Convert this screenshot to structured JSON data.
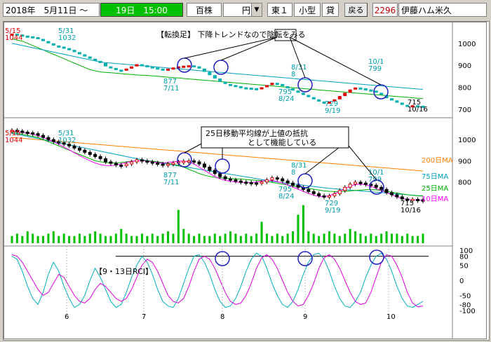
{
  "toolbar": {
    "date": "2018年　5月11日 ～",
    "time": "19日　15:00",
    "unit_label": "百株",
    "price_unit": "円",
    "dropdown_icon": "triangle-down",
    "market": "東１",
    "size": "小型",
    "lend": "貸",
    "back_label": "戻る",
    "code": "2296",
    "name": "伊藤ハム米久"
  },
  "annotations": {
    "top_note": "【転換足】 下降トレンドなので陰転をみる",
    "mid_note_line1": "25日移動平均線が上値の抵抗",
    "mid_note_line2": "として機能している",
    "rci_label": "【9・13日RCI】"
  },
  "colors": {
    "toolbar_time_bg": "#00c000",
    "ma200": "#ff8000",
    "ma75": "#00a0c0",
    "ma25": "#00b000",
    "ma10": "#ff00ff",
    "turn_up": "#e00000",
    "turn_down": "#00b0b0",
    "volume": "#00c000",
    "rci9": "#00b0c0",
    "rci13": "#e000e0",
    "circle": "#2020c0",
    "arrow": "#000000"
  },
  "chart_data": [
    {
      "type": "line",
      "panel": "turnover_bars",
      "title": "【転換足】 下降トレンドなので陰転をみる",
      "ylim": [
        690,
        1060
      ],
      "yticks": [
        700,
        800,
        900,
        1000
      ],
      "xlabels": [
        "6",
        "7",
        "8",
        "9",
        "10"
      ],
      "price_labels": [
        {
          "value": "5/15",
          "sub": "1044"
        },
        {
          "value": "5/31",
          "sub": "1032"
        },
        {
          "value": "877",
          "sub": "7/11"
        },
        {
          "value": "795",
          "sub": "8/24"
        },
        {
          "value": "8/31",
          "sub": "8"
        },
        {
          "value": "729",
          "sub": "9/19"
        },
        {
          "value": "10/1",
          "sub": "799"
        },
        {
          "value": "715",
          "sub": "10/16"
        }
      ],
      "series": [
        {
          "values": [
            1044,
            1040,
            1035,
            1032,
            1028,
            1020,
            1010,
            1000,
            990,
            985,
            978,
            970,
            960,
            950,
            940,
            930,
            920,
            910,
            895,
            888,
            880,
            877,
            885,
            895,
            905,
            900,
            895,
            890,
            885,
            880,
            885,
            890,
            895,
            898,
            900,
            895,
            885,
            870,
            855,
            840,
            825,
            815,
            810,
            805,
            800,
            798,
            796,
            795,
            800,
            810,
            820,
            815,
            805,
            795,
            785,
            775,
            765,
            755,
            745,
            735,
            729,
            735,
            745,
            760,
            775,
            790,
            799,
            795,
            790,
            785,
            775,
            765,
            750,
            740,
            730,
            720,
            715,
            718,
            716,
            715
          ]
        }
      ],
      "ma_values": [
        {
          "values": [
            1020,
            1015,
            1010,
            1000,
            990,
            980,
            970,
            960,
            950,
            940,
            930,
            920,
            910,
            900,
            890,
            880,
            875,
            870,
            868,
            866,
            864,
            862,
            860,
            858,
            856,
            855,
            854,
            852,
            850,
            848,
            846,
            844,
            842,
            840,
            838,
            836,
            834,
            832,
            830,
            828,
            826,
            824,
            822,
            820,
            818,
            816,
            814,
            812,
            810,
            808,
            806,
            804,
            802,
            800,
            798,
            796,
            794,
            792,
            790,
            788,
            786,
            784,
            782,
            780,
            778,
            776,
            774,
            772,
            770,
            768,
            766,
            764,
            762,
            760,
            758,
            756,
            754,
            752,
            750,
            748
          ]
        },
        {
          "values": [
            1000,
            995,
            990,
            985,
            980,
            975,
            970,
            965,
            960,
            955,
            950,
            945,
            940,
            935,
            930,
            925,
            920,
            915,
            912,
            910,
            908,
            906,
            904,
            902,
            900,
            898,
            896,
            894,
            892,
            890,
            888,
            886,
            884,
            882,
            880,
            878,
            876,
            874,
            872,
            870,
            868,
            866,
            864,
            862,
            860,
            858,
            856,
            854,
            852,
            850,
            848,
            846,
            844,
            842,
            840,
            838,
            836,
            834,
            832,
            830,
            828,
            826,
            824,
            822,
            820,
            818,
            816,
            814,
            812,
            810,
            808,
            806,
            804,
            802,
            800,
            798,
            796,
            794,
            792,
            790
          ]
        }
      ]
    },
    {
      "type": "line",
      "panel": "candles_ma",
      "title": "25日移動平均線が上値の抵抗 として機能している",
      "ylim": [
        690,
        1060
      ],
      "yticks": [
        800,
        900,
        1000
      ],
      "legend": [
        "200日MA",
        "75日MA",
        "25日MA",
        "10日MA"
      ],
      "legend_placement": "right",
      "price_labels": [
        {
          "value": "5/15",
          "sub": "1044"
        },
        {
          "value": "5/31",
          "sub": "1032"
        },
        {
          "value": "877",
          "sub": "7/11"
        },
        {
          "value": "795",
          "sub": "8/24"
        },
        {
          "value": "8/31",
          "sub": "8"
        },
        {
          "value": "729",
          "sub": "9/19"
        },
        {
          "value": "10/1",
          "sub": "799"
        },
        {
          "value": "715",
          "sub": "10/16"
        }
      ],
      "series": [
        {
          "name": "200日MA",
          "values": [
            1010,
            1008,
            1006,
            1004,
            1002,
            1000,
            998,
            996,
            994,
            992,
            990,
            988,
            986,
            984,
            982,
            980,
            978,
            976,
            974,
            972,
            970,
            968,
            966,
            964,
            962,
            960,
            958,
            956,
            954,
            952,
            950,
            948,
            946,
            944,
            942,
            940,
            938,
            936,
            934,
            932,
            930,
            928,
            926,
            924,
            922,
            920,
            918,
            916,
            914,
            912,
            910,
            908,
            906,
            904,
            902,
            900,
            898,
            896,
            894,
            892,
            890,
            888,
            886,
            884,
            882,
            880,
            878,
            876,
            874,
            872,
            870,
            868,
            866,
            864,
            862,
            860,
            858,
            856,
            854,
            852
          ]
        },
        {
          "name": "75日MA",
          "values": [
            1030,
            1025,
            1020,
            1015,
            1010,
            1005,
            1000,
            995,
            990,
            985,
            980,
            975,
            970,
            965,
            960,
            955,
            950,
            945,
            940,
            935,
            930,
            925,
            920,
            915,
            910,
            905,
            900,
            896,
            892,
            888,
            884,
            880,
            876,
            872,
            868,
            864,
            860,
            856,
            852,
            848,
            844,
            840,
            836,
            832,
            828,
            824,
            820,
            816,
            812,
            808,
            804,
            800,
            797,
            794,
            791,
            788,
            785,
            782,
            779,
            776,
            773,
            770,
            768,
            766,
            764,
            762,
            760,
            758,
            756,
            754,
            752,
            750,
            748,
            746,
            744,
            742,
            740,
            738,
            736,
            735
          ]
        },
        {
          "name": "25日MA",
          "values": [
            1035,
            1030,
            1025,
            1020,
            1015,
            1010,
            1000,
            990,
            980,
            970,
            960,
            950,
            940,
            930,
            920,
            910,
            900,
            895,
            892,
            890,
            890,
            892,
            895,
            898,
            900,
            901,
            900,
            898,
            895,
            892,
            888,
            884,
            878,
            870,
            860,
            850,
            840,
            832,
            826,
            822,
            820,
            818,
            816,
            815,
            814,
            812,
            810,
            808,
            806,
            802,
            798,
            794,
            790,
            786,
            782,
            778,
            774,
            770,
            766,
            762,
            758,
            756,
            755,
            755,
            756,
            758,
            760,
            762,
            764,
            764,
            763,
            760,
            756,
            752,
            748,
            744,
            740,
            737,
            735,
            734
          ]
        },
        {
          "name": "10日MA",
          "values": [
            1040,
            1037,
            1034,
            1030,
            1025,
            1018,
            1010,
            1000,
            990,
            978,
            965,
            952,
            938,
            925,
            912,
            900,
            890,
            882,
            878,
            877,
            880,
            886,
            892,
            897,
            900,
            900,
            898,
            895,
            892,
            890,
            892,
            895,
            898,
            899,
            895,
            885,
            870,
            855,
            840,
            826,
            815,
            808,
            803,
            800,
            798,
            797,
            797,
            800,
            805,
            808,
            807,
            802,
            795,
            786,
            776,
            766,
            756,
            746,
            738,
            732,
            731,
            736,
            745,
            756,
            768,
            780,
            788,
            790,
            786,
            780,
            770,
            760,
            750,
            740,
            730,
            722,
            718,
            716,
            715,
            715
          ]
        }
      ]
    },
    {
      "type": "bar",
      "panel": "volume",
      "values": [
        3,
        4,
        3,
        5,
        4,
        3,
        3,
        4,
        5,
        3,
        4,
        3,
        3,
        4,
        3,
        4,
        5,
        4,
        3,
        3,
        4,
        6,
        4,
        3,
        3,
        4,
        3,
        4,
        3,
        4,
        5,
        4,
        14,
        6,
        4,
        3,
        4,
        3,
        3,
        4,
        3,
        4,
        5,
        4,
        3,
        4,
        3,
        4,
        9,
        4,
        3,
        4,
        3,
        4,
        5,
        12,
        16,
        5,
        4,
        3,
        4,
        5,
        4,
        3,
        4,
        6,
        5,
        4,
        3,
        4,
        3,
        4,
        5,
        4,
        4,
        3,
        4,
        3,
        3,
        4
      ],
      "ylim": [
        0,
        18
      ]
    },
    {
      "type": "line",
      "panel": "rci",
      "title": "【9・13日RCI】",
      "ylim": [
        -100,
        100
      ],
      "yticks": [
        100,
        80,
        50,
        0,
        -50,
        -80,
        -100
      ],
      "xlabels": [
        "6",
        "7",
        "8",
        "9",
        "10"
      ],
      "series": [
        {
          "name": "9日RCI",
          "values": [
            80,
            70,
            30,
            -20,
            -60,
            -80,
            -40,
            20,
            60,
            30,
            -20,
            -60,
            -90,
            -80,
            -50,
            0,
            40,
            10,
            -30,
            -70,
            -90,
            -80,
            -40,
            10,
            50,
            80,
            60,
            20,
            -30,
            -70,
            -85,
            -90,
            -60,
            -10,
            40,
            80,
            85,
            60,
            20,
            -30,
            -70,
            -90,
            -85,
            -60,
            -20,
            30,
            70,
            90,
            80,
            40,
            -10,
            -50,
            -80,
            -90,
            -70,
            -30,
            20,
            60,
            85,
            90,
            70,
            30,
            -20,
            -60,
            -85,
            -90,
            -70,
            -40,
            10,
            50,
            80,
            90,
            70,
            30,
            -20,
            -60,
            -85,
            -90,
            -80,
            -70
          ]
        },
        {
          "name": "13日RCI",
          "values": [
            85,
            80,
            60,
            30,
            0,
            -30,
            -50,
            -40,
            -10,
            20,
            10,
            -20,
            -50,
            -70,
            -75,
            -60,
            -30,
            -10,
            -20,
            -40,
            -60,
            -70,
            -60,
            -30,
            10,
            50,
            70,
            60,
            30,
            -10,
            -50,
            -70,
            -75,
            -60,
            -20,
            30,
            70,
            80,
            70,
            40,
            0,
            -40,
            -70,
            -80,
            -75,
            -50,
            -10,
            40,
            75,
            85,
            70,
            40,
            0,
            -40,
            -70,
            -85,
            -80,
            -50,
            -10,
            40,
            75,
            85,
            70,
            40,
            0,
            -40,
            -70,
            -80,
            -75,
            -40,
            10,
            60,
            85,
            80,
            50,
            10,
            -40,
            -75,
            -88,
            -85
          ]
        }
      ]
    }
  ]
}
